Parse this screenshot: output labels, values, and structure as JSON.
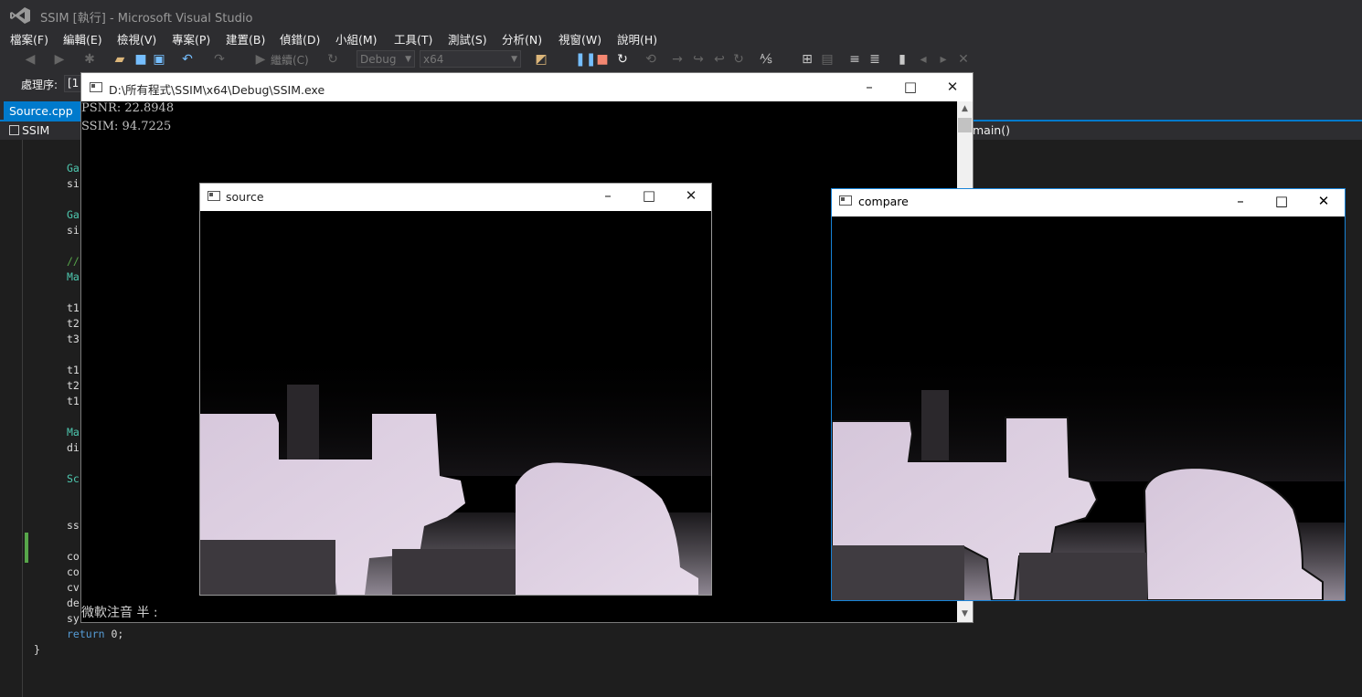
{
  "vs": {
    "title": "SSIM [執行] - Microsoft Visual Studio",
    "menu": [
      "檔案(F)",
      "編輯(E)",
      "檢視(V)",
      "專案(P)",
      "建置(B)",
      "偵錯(D)",
      "小組(M)",
      "工具(T)",
      "測試(S)",
      "分析(N)",
      "視窗(W)",
      "說明(H)"
    ],
    "toolbar": {
      "continue_label": "繼續(C)",
      "config": "Debug",
      "platform": "x64"
    },
    "process_label": "處理序:",
    "process_value": "[1",
    "active_tab": "Source.cpp",
    "nav_project": "SSIM",
    "nav_function": "main()",
    "code": {
      "lines": [
        "Ga",
        "si",
        "Ga",
        "si",
        "//",
        "Ma",
        "t1",
        "t2",
        "t3",
        "t1",
        "t2",
        "t1",
        "Ma",
        "di",
        "Sc",
        "ss",
        "co",
        "co",
        "cv",
        "de",
        "sy"
      ],
      "return_kw": "return",
      "return_val": " 0;",
      "close_brace": "}"
    }
  },
  "console": {
    "title": "D:\\所有程式\\SSIM\\x64\\Debug\\SSIM.exe",
    "psnr": "PSNR: 22.8948",
    "ssim": "SSIM: 94.7225",
    "ime": "微軟注音 半 :"
  },
  "source_window": {
    "title": "source"
  },
  "compare_window": {
    "title": "compare"
  },
  "colors": {
    "accent": "#007acc",
    "depth_object": "#ddd0e2"
  }
}
